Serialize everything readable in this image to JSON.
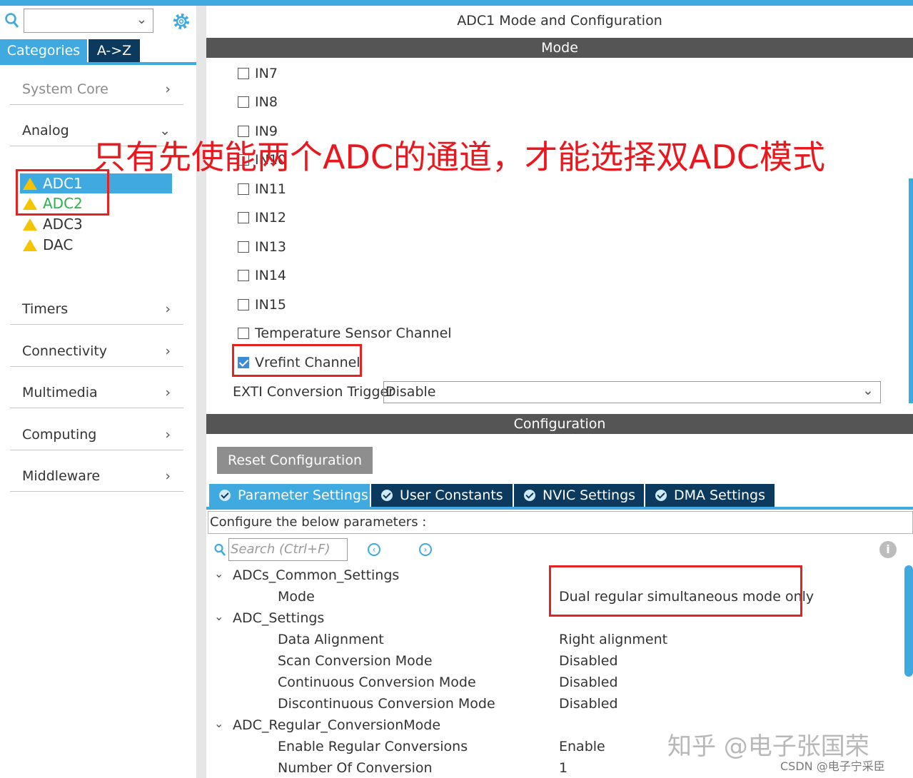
{
  "sidebar": {
    "search_value": "",
    "tabs": [
      "Categories",
      "A->Z"
    ],
    "categories": [
      {
        "label": "System Core"
      },
      {
        "label": "Analog"
      },
      {
        "label": "Timers"
      },
      {
        "label": "Connectivity"
      },
      {
        "label": "Multimedia"
      },
      {
        "label": "Computing"
      },
      {
        "label": "Middleware"
      }
    ],
    "analog_items": [
      {
        "label": "ADC1",
        "selected": true
      },
      {
        "label": "ADC2"
      },
      {
        "label": "ADC3"
      },
      {
        "label": "DAC"
      }
    ]
  },
  "main": {
    "title": "ADC1 Mode and Configuration",
    "mode_header": "Mode",
    "channels": [
      {
        "label": "IN7",
        "checked": false
      },
      {
        "label": "IN8",
        "checked": false
      },
      {
        "label": "IN9",
        "checked": false
      },
      {
        "label": "IN10",
        "checked": false
      },
      {
        "label": "IN11",
        "checked": false
      },
      {
        "label": "IN12",
        "checked": false
      },
      {
        "label": "IN13",
        "checked": false
      },
      {
        "label": "IN14",
        "checked": false
      },
      {
        "label": "IN15",
        "checked": false
      },
      {
        "label": "Temperature Sensor Channel",
        "checked": false
      },
      {
        "label": "Vrefint Channel",
        "checked": true
      }
    ],
    "exti_label": "EXTI Conversion Trigger",
    "exti_value": "Disable",
    "config_header": "Configuration",
    "reset_label": "Reset Configuration",
    "config_tabs": [
      "Parameter Settings",
      "User Constants",
      "NVIC Settings",
      "DMA Settings"
    ],
    "param_hint": "Configure the below parameters :",
    "search_placeholder": "Search (Ctrl+F)",
    "params": [
      {
        "label": "ADCs_Common_Settings",
        "group": true,
        "value": ""
      },
      {
        "label": "Mode",
        "group": false,
        "value": "Dual regular simultaneous mode only"
      },
      {
        "label": "ADC_Settings",
        "group": true,
        "value": ""
      },
      {
        "label": "Data Alignment",
        "group": false,
        "value": "Right alignment"
      },
      {
        "label": "Scan Conversion Mode",
        "group": false,
        "value": "Disabled"
      },
      {
        "label": "Continuous Conversion Mode",
        "group": false,
        "value": "Disabled"
      },
      {
        "label": "Discontinuous Conversion Mode",
        "group": false,
        "value": "Disabled"
      },
      {
        "label": "ADC_Regular_ConversionMode",
        "group": true,
        "value": ""
      },
      {
        "label": "Enable Regular Conversions",
        "group": false,
        "value": "Enable"
      },
      {
        "label": "Number Of Conversion",
        "group": false,
        "value": "1"
      }
    ]
  },
  "annotation": "只有先使能两个ADC的通道，才能选择双ADC模式",
  "watermark": "知乎 @电子张国荣",
  "credit": "CSDN @电子宁采臣",
  "colors": {
    "accent": "#3fa9e0",
    "dark_tab": "#0b3a5e",
    "annotation": "#e8181e",
    "warning": "#f5c400"
  }
}
